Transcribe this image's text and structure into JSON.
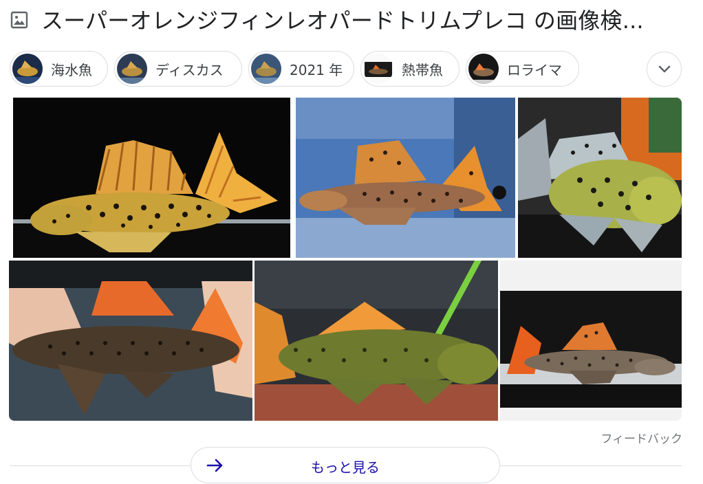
{
  "header": {
    "icon": "image-icon",
    "title": "スーパーオレンジフィンレオパードトリムプレコ の画像検..."
  },
  "chips": [
    {
      "label": "海水魚"
    },
    {
      "label": "ディスカス"
    },
    {
      "label": "2021 年"
    },
    {
      "label": "熱帯魚"
    },
    {
      "label": "ロライマ"
    }
  ],
  "chips_more_icon": "chevron-down-icon",
  "images": [
    {
      "name": "image-result-1"
    },
    {
      "name": "image-result-2"
    },
    {
      "name": "image-result-3"
    },
    {
      "name": "image-result-4"
    },
    {
      "name": "image-result-5"
    },
    {
      "name": "image-result-6"
    }
  ],
  "footer": {
    "feedback": "フィードバック",
    "more_label": "もっと見る",
    "more_icon": "arrow-right-icon",
    "accent_color": "#1a0dab"
  }
}
